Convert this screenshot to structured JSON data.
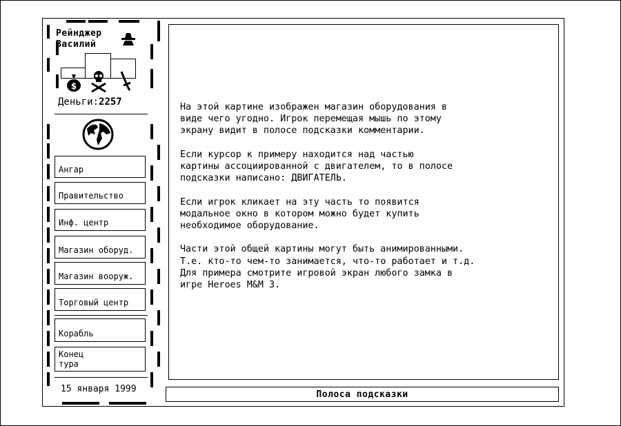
{
  "player": {
    "rank": "Рейнджер",
    "name": "Василий",
    "money_label": "Деньги:",
    "money_value": "2257",
    "icons": [
      "spy-icon",
      "money-bag-icon",
      "skull-crossbones-icon",
      "sword-icon",
      "globe-icon"
    ],
    "stats_bars": [
      0.2,
      0.55,
      0.35
    ]
  },
  "menu": {
    "hangar": "Ангар",
    "government": "Правительство",
    "info_center": "Инф. центр",
    "equipment_shop": "Магазин оборуд.",
    "weapon_shop": "Магазин вооруж.",
    "trade_center": "Торговый центр",
    "ship": "Корабль",
    "end_turn": "Конец\nтура"
  },
  "date": "15 января 1999",
  "main": {
    "paragraphs": [
      "На этой картине изображен магазин оборудования в\nвиде чего угодно. Игрок перемещая мышь по этому\nэкрану видит в полосе подсказки комментарии.",
      "Если курсор к примеру находится над частью\nкартины ассоциированной с двигателем, то в полосе\nподсказки написано: ДВИГАТЕЛЬ.",
      "Если игрок кликает на эту часть то появится\nмодальное окно в котором можно будет купить\nнеобходимое оборудование.",
      "Части этой общей картины могут быть анимированными.\nТ.е. кто-то чем-то занимается, что-то работает и т.д.\nДля примера смотрите игровой экран любого замка в\nигре Heroes M&M 3."
    ]
  },
  "hint_bar": "Полоса подсказки"
}
